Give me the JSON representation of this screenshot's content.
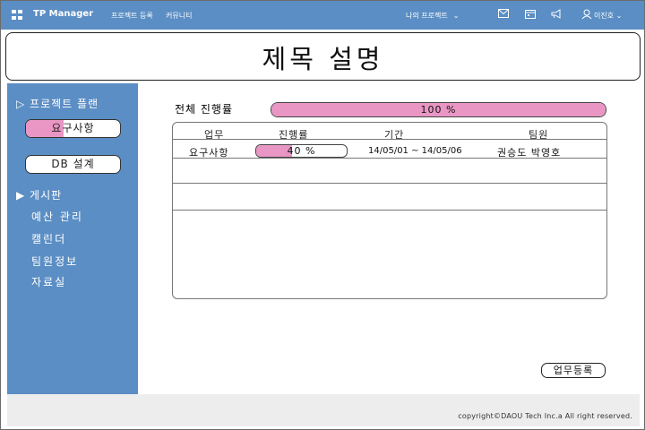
{
  "header": {
    "app_title": "TP Manager",
    "nav": [
      "프로젝트 등록",
      "커뮤니티"
    ],
    "my_projects": "나의 프로젝트",
    "user_name": "이진호",
    "icons": [
      "grid-logo-icon",
      "mail-icon",
      "calendar-icon",
      "megaphone-icon",
      "user-icon"
    ]
  },
  "page": {
    "title": "제목 설명"
  },
  "sidebar": {
    "project_plan": "▷ 프로젝트 플랜",
    "buttons": [
      "요구사항",
      "DB 설계"
    ],
    "requirements_progress": 0.4,
    "board": "▶ 게시판",
    "items": [
      "예산 관리",
      "캘린더",
      "팀원정보",
      "자료실"
    ]
  },
  "overall": {
    "label": "전체 진행률",
    "progress_text": "100 %",
    "progress": 1.0
  },
  "table": {
    "headers": [
      "업무",
      "진행률",
      "기간",
      "팀원"
    ],
    "rows": [
      {
        "task": "요구사항",
        "progress_text": "40 %",
        "progress": 0.4,
        "period": "14/05/01 ~ 14/05/06",
        "members": "권승도 박영호"
      }
    ]
  },
  "actions": {
    "register": "업무등록"
  },
  "footer": {
    "copyright": "copyright©DAOU Tech Inc.a All right reserved."
  },
  "colors": {
    "primary": "#5b8ec4",
    "progress_fill": "#e996c4",
    "footer_bg": "#ededed"
  }
}
